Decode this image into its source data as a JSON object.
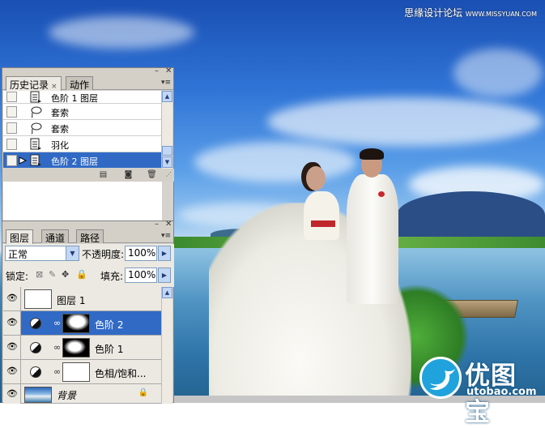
{
  "watermark_top": {
    "cn": "思缘设计论坛",
    "url": "WWW.MISSYUAN.COM"
  },
  "watermark_bottom": {
    "cn": "优图宝",
    "url": "utobao.com"
  },
  "history_panel": {
    "tabs": [
      {
        "label": "历史记录",
        "close": "×"
      },
      {
        "label": "动作"
      }
    ],
    "rows": [
      {
        "label": "色阶 1 图层",
        "icon": "document-step-icon"
      },
      {
        "label": "套索",
        "icon": "lasso-icon"
      },
      {
        "label": "套索",
        "icon": "lasso-icon"
      },
      {
        "label": "羽化",
        "icon": "document-step-icon"
      },
      {
        "label": "色阶 2 图层",
        "icon": "document-step-icon",
        "selected": true
      }
    ],
    "footer_icons": [
      "new-document-from-state-icon",
      "new-snapshot-icon",
      "trash-icon"
    ]
  },
  "layers_panel": {
    "tabs": [
      {
        "label": "图层"
      },
      {
        "label": "通道"
      },
      {
        "label": "路径"
      }
    ],
    "blend_mode": "正常",
    "opacity_label": "不透明度:",
    "opacity_value": "100%",
    "lock_label": "锁定:",
    "fill_label": "填充:",
    "fill_value": "100%",
    "layers": [
      {
        "name": "图层 1",
        "type": "pixel",
        "visible": true
      },
      {
        "name": "色阶 2",
        "type": "adjustment",
        "visible": true,
        "selected": true
      },
      {
        "name": "色阶 1",
        "type": "adjustment",
        "visible": true
      },
      {
        "name": "色相/饱和...",
        "type": "adjustment",
        "visible": true
      },
      {
        "name": "背景",
        "type": "background",
        "visible": true,
        "locked": true
      }
    ]
  },
  "colors": {
    "selection": "#316ac5",
    "panel": "#d4d0c8",
    "scroll": "#c2d7f5"
  }
}
